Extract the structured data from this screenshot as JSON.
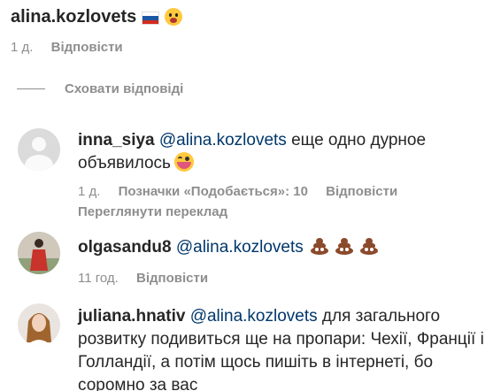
{
  "top_comment": {
    "username": "alina.kozlovets",
    "time": "1 д.",
    "reply_label": "Відповісти",
    "flag_colors": [
      "#ffffff",
      "#1c57a5",
      "#d52b1e"
    ]
  },
  "hide_replies_label": "Сховати відповіді",
  "replies": [
    {
      "username": "inna_siya",
      "mention": "@alina.kozlovets",
      "text": " еще одно дурное объявилось",
      "time": "1 д.",
      "likes_label": "Позначки «Подобається»: 10",
      "reply_label": "Відповісти",
      "translation_label": "Переглянути переклад",
      "emoji": "laughing-face"
    },
    {
      "username": "olgasandu8",
      "mention": "@alina.kozlovets",
      "text": "",
      "time": "11 год.",
      "reply_label": "Відповісти",
      "emoji": "poop x3"
    },
    {
      "username": "juliana.hnativ",
      "mention": "@alina.kozlovets",
      "text": " для загального розвитку подивиться ще на пропари: Чехії, Франції і Голландії, а потім щось пишіть в інтернеті, бо соромно за вас"
    }
  ]
}
